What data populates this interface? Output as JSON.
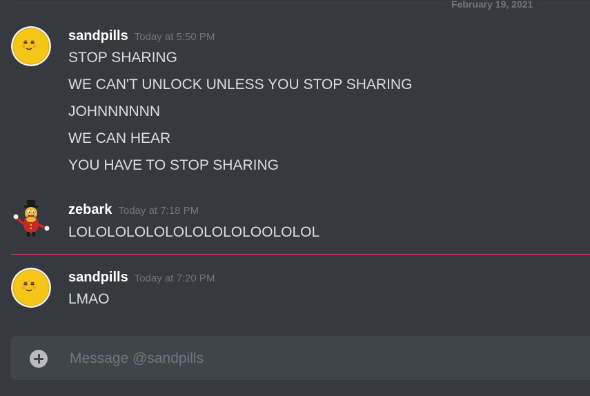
{
  "date_divider": "February 19, 2021",
  "groups": [
    {
      "author": "sandpills",
      "timestamp": "Today at 5:50 PM",
      "avatar": "smiley-moon-avatar",
      "lines": [
        "STOP SHARING",
        "WE CAN'T UNLOCK UNLESS YOU STOP SHARING",
        "JOHNNNNNN",
        "WE CAN HEAR",
        "YOU HAVE TO STOP SHARING"
      ]
    },
    {
      "author": "zebark",
      "timestamp": "Today at 7:18 PM",
      "avatar": "peanut-character-avatar",
      "lines": [
        "LOLOLOLOLOLOLOLOLOLOOLOLOL"
      ]
    },
    {
      "author": "sandpills",
      "timestamp": "Today at 7:20 PM",
      "avatar": "smiley-moon-avatar",
      "lines": [
        "LMAO"
      ]
    }
  ],
  "composer": {
    "placeholder": "Message @sandpills",
    "value": "",
    "add_icon": "plus-circle-icon"
  },
  "colors": {
    "background": "#36393f",
    "composer": "#40444b",
    "new_messages_divider": "#f04747",
    "author": "#ffffff",
    "timestamp": "#72767d",
    "message_text": "#dcddde"
  }
}
